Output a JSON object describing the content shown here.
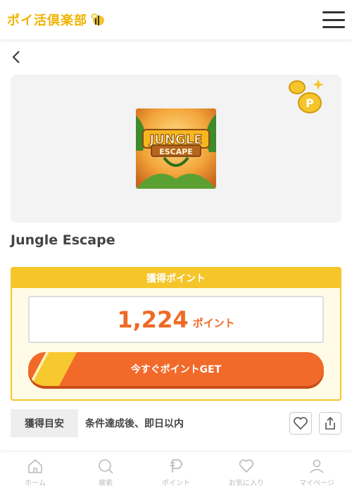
{
  "header": {
    "logo_text": "ポイ活倶楽部",
    "logo_icon": "bee-icon",
    "menu_icon": "hamburger-icon"
  },
  "nav": {
    "back_icon": "chevron-left-icon"
  },
  "app": {
    "title": "Jungle Escape",
    "icon_text_top": "JUNGLE",
    "icon_text_bottom": "ESCAPE"
  },
  "points": {
    "header": "獲得ポイント",
    "value": "1,224",
    "unit": "ポイント",
    "button_label": "今すぐポイントGET"
  },
  "rule": {
    "tag": "獲得目安",
    "text": "条件達成後、即日以内"
  },
  "actions": {
    "favorite_icon": "heart-icon",
    "share_icon": "share-icon"
  },
  "bottom_nav": [
    {
      "label": "ホーム",
      "icon": "home-icon"
    },
    {
      "label": "検索",
      "icon": "search-icon"
    },
    {
      "label": "ポイント",
      "icon": "point-p-icon"
    },
    {
      "label": "お気に入り",
      "icon": "heart-icon"
    },
    {
      "label": "マイページ",
      "icon": "user-icon"
    }
  ],
  "colors": {
    "brand_yellow": "#f5c52a",
    "accent_orange": "#f26a2a",
    "text_dark": "#444444"
  }
}
